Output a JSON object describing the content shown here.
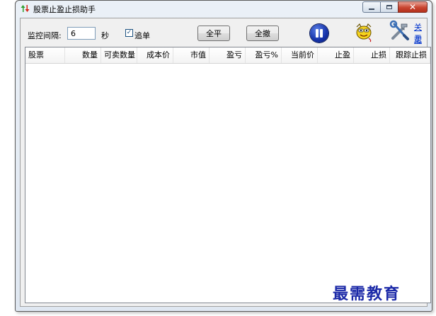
{
  "window": {
    "title": "股票止盈止损助手",
    "caption": {
      "close": "✕"
    }
  },
  "toolbar": {
    "interval_label": "监控间隔:",
    "interval_value": "6",
    "interval_unit": "秒",
    "chase_checked": true,
    "chase_checkmark": "✓",
    "chase_label": "追单",
    "close_all_label": "全平",
    "cancel_all_label": "全撤",
    "about_link": "关于",
    "help_link": "帮助"
  },
  "icons": {
    "app": "up-down-arrows-icon",
    "pause": "pause-icon",
    "smiley": "smiley-icon",
    "tools": "tools-icon"
  },
  "table": {
    "columns": [
      "股票",
      "数量",
      "可卖数量",
      "成本价",
      "市值",
      "盈亏",
      "盈亏%",
      "当前价",
      "止盈",
      "止损",
      "跟踪止损"
    ],
    "rows": []
  },
  "watermark": "最需教育",
  "colors": {
    "link": "#0033cc",
    "close_button": "#c8442f",
    "pause_button": "#1431a8",
    "watermark": "#1c2aa8"
  }
}
